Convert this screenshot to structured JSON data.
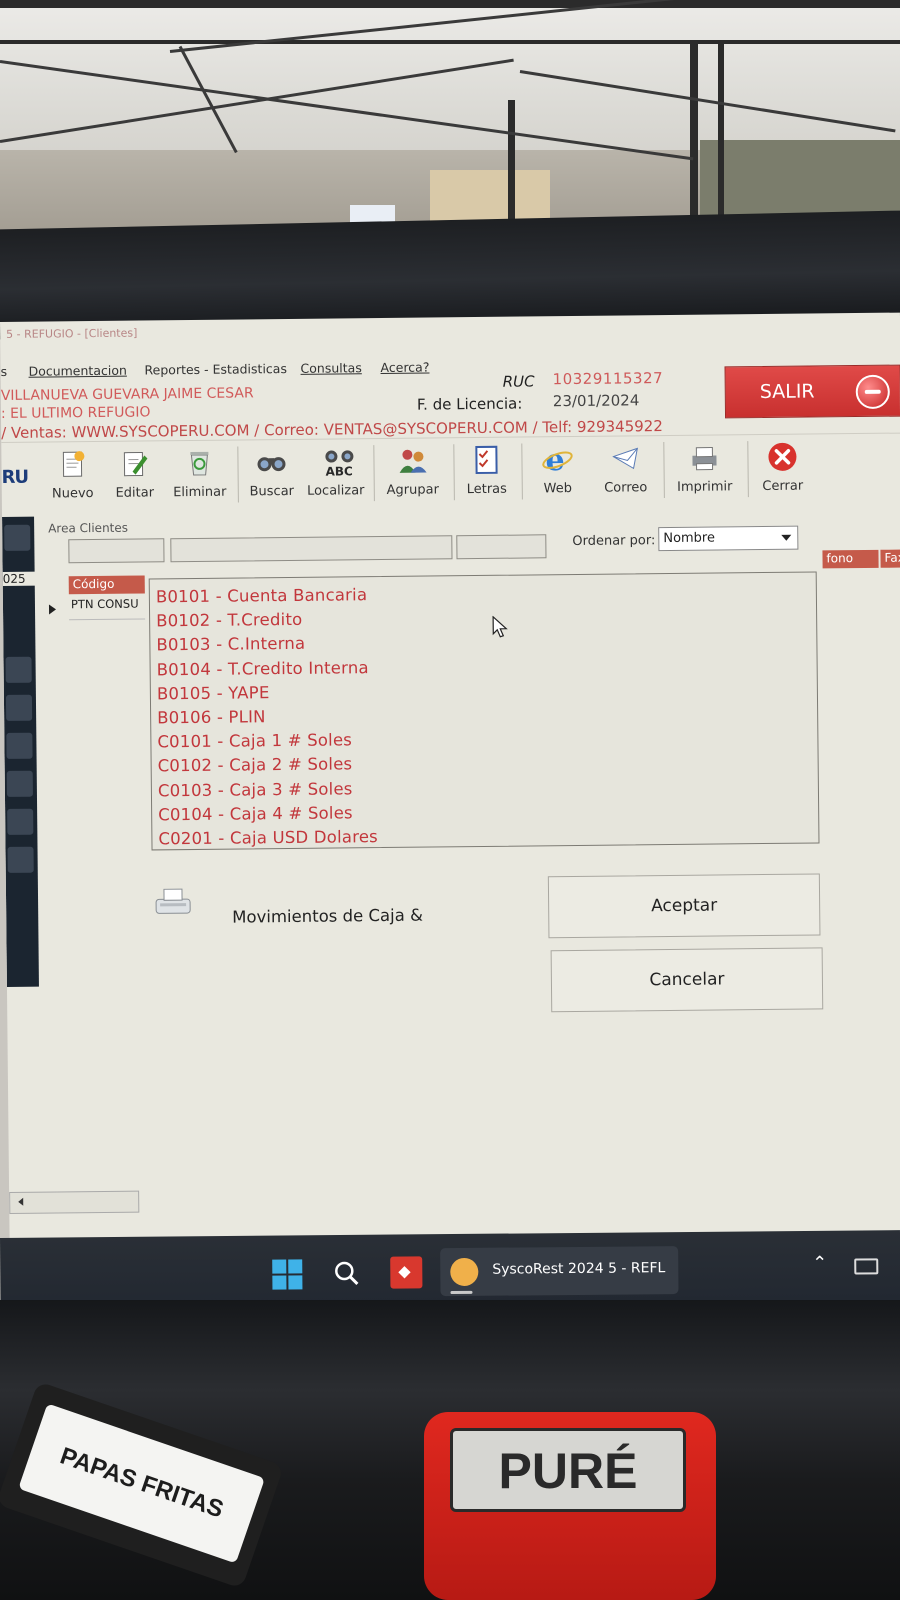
{
  "window": {
    "title": "5 - REFUGIO - [Clientes]"
  },
  "menu": {
    "items": [
      {
        "label": "s"
      },
      {
        "label": "Documentacion"
      },
      {
        "label": "Reportes - Estadisticas"
      },
      {
        "label": "Consultas"
      },
      {
        "label": "Acerca?"
      }
    ]
  },
  "header": {
    "owner": "VILLANUEVA GUEVARA JAIME CESAR",
    "business": ": EL ULTIMO REFUGIO",
    "contact": "/ Ventas: WWW.SYSCOPERU.COM / Correo: VENTAS@SYSCOPERU.COM / Telf: 929345922",
    "ruc_label": "RUC",
    "ruc_value": "10329115327",
    "license_label": "F. de Licencia:",
    "license_value": "23/01/2024",
    "exit_label": "SALIR"
  },
  "brand": {
    "logo_text": "RU"
  },
  "toolbar": {
    "nuevo": "Nuevo",
    "editar": "Editar",
    "eliminar": "Eliminar",
    "buscar": "Buscar",
    "localizar": "Localizar",
    "agrupar": "Agrupar",
    "letras": "Letras",
    "web": "Web",
    "correo": "Correo",
    "imprimir": "Imprimir",
    "cerrar": "Cerrar"
  },
  "sidebar": {
    "year_fragment": "025"
  },
  "clients": {
    "area_label": "Area Clientes",
    "order_label": "Ordenar por:",
    "order_value": "Nombre",
    "grid": {
      "code_header": "Código",
      "row_code": "PTN CONSU",
      "col_phone": "fono",
      "col_fax": "Fax"
    }
  },
  "accounts": [
    "B0101 - Cuenta Bancaria",
    "B0102 - T.Credito",
    "B0103 - C.Interna",
    "B0104 - T.Credito Interna",
    "B0105 - YAPE",
    "B0106 - PLIN",
    "C0101 - Caja 1 # Soles",
    "C0102 - Caja 2 # Soles",
    "C0103 - Caja 3 # Soles",
    "C0104 - Caja 4 # Soles",
    "C0201 - Caja USD Dolares"
  ],
  "dialog": {
    "title": "Movimientos de Caja &",
    "accept": "Aceptar",
    "cancel": "Cancelar"
  },
  "taskbar": {
    "app_label": "SyscoRest 2024 5 - REFL"
  },
  "desk": {
    "stamp_left": "PAPAS FRITAS",
    "stamp_right": "PURÉ"
  },
  "colors": {
    "accent_red": "#c2373c",
    "exit_button": "#d63c3a",
    "header_text": "#d15a5a",
    "grid_header": "#c55a4a",
    "taskbar": "#252b33"
  }
}
